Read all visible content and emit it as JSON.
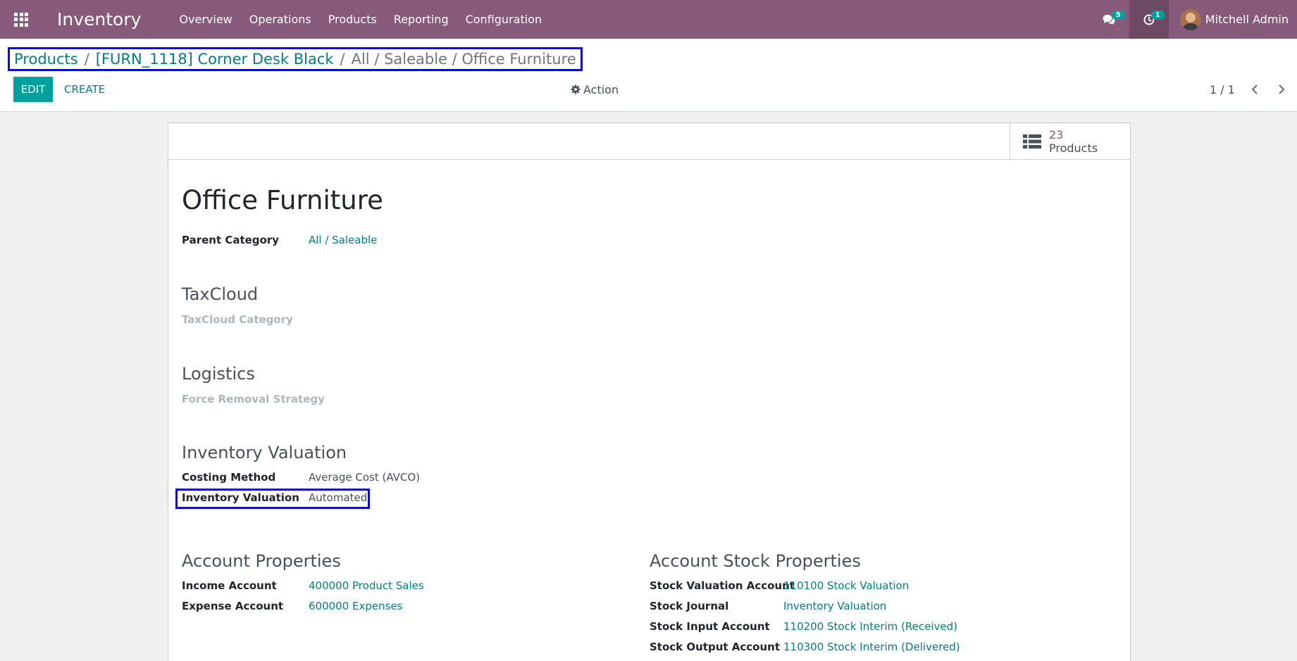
{
  "navbar": {
    "app_name": "Inventory",
    "menu": [
      "Overview",
      "Operations",
      "Products",
      "Reporting",
      "Configuration"
    ],
    "messages_count": "5",
    "activities_count": "1",
    "user_name": "Mitchell Admin"
  },
  "breadcrumb": {
    "item1": "Products",
    "item2": "[FURN_1118] Corner Desk Black",
    "current": "All / Saleable / Office Furniture",
    "separator": "/"
  },
  "toolbar": {
    "edit_label": "EDIT",
    "create_label": "CREATE",
    "action_label": "Action",
    "pager": "1 / 1"
  },
  "stat_button": {
    "value": "23",
    "label": "Products"
  },
  "form": {
    "title": "Office Furniture",
    "parent_category_label": "Parent Category",
    "parent_category_value": "All / Saleable",
    "taxcloud_title": "TaxCloud",
    "taxcloud_category_label": "TaxCloud Category",
    "logistics_title": "Logistics",
    "removal_strategy_label": "Force Removal Strategy",
    "valuation_title": "Inventory Valuation",
    "costing_method_label": "Costing Method",
    "costing_method_value": "Average Cost (AVCO)",
    "inventory_valuation_label": "Inventory Valuation",
    "inventory_valuation_value": "Automated",
    "account_properties_title": "Account Properties",
    "income_account_label": "Income Account",
    "income_account_value": "400000 Product Sales",
    "expense_account_label": "Expense Account",
    "expense_account_value": "600000 Expenses",
    "stock_properties_title": "Account Stock Properties",
    "stock_valuation_label": "Stock Valuation Account",
    "stock_valuation_value": "110100 Stock Valuation",
    "stock_journal_label": "Stock Journal",
    "stock_journal_value": "Inventory Valuation",
    "stock_input_label": "Stock Input Account",
    "stock_input_value": "110200 Stock Interim (Received)",
    "stock_output_label": "Stock Output Account",
    "stock_output_value": "110300 Stock Interim (Delivered)"
  },
  "colors": {
    "navbar": "#875a7b",
    "link": "#017e84",
    "primary_button": "#00a09d",
    "highlight_box": "#0b0bdb"
  }
}
